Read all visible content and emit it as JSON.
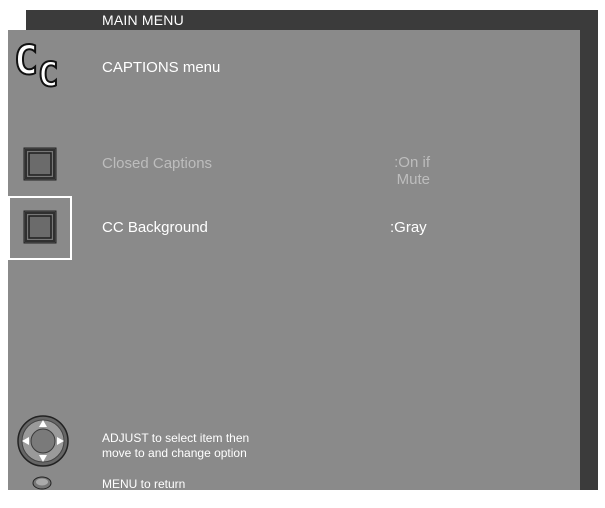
{
  "header": {
    "title": "MAIN MENU"
  },
  "menu": {
    "title": "CAPTIONS menu",
    "logo_text": "CC"
  },
  "rows": [
    {
      "label": "Closed Captions",
      "value_line1": ":On if",
      "value_line2": "Mute",
      "state": "disabled"
    },
    {
      "label": "CC Background",
      "value_line1": ":Gray",
      "value_line2": "",
      "state": "selected"
    }
  ],
  "footer": {
    "adjust_line1": "ADJUST to select item then",
    "adjust_line2": "move to and change option",
    "menu_text": "MENU to return"
  },
  "colors": {
    "panel": "#8a8a8a",
    "header": "#3b3b3b",
    "text": "#ffffff",
    "dim_text": "#bdbdbd"
  },
  "icons": {
    "logo": "cc-icon",
    "row_bullet": "square-button-icon",
    "adjust": "adjust-dial-icon",
    "menu": "menu-button-icon"
  }
}
